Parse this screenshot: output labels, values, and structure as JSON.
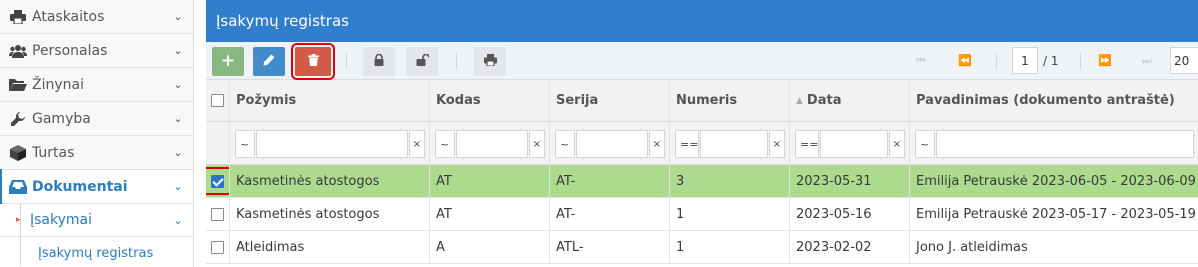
{
  "sidebar": {
    "items": [
      {
        "label": "Ataskaitos",
        "icon": "printer-icon"
      },
      {
        "label": "Personalas",
        "icon": "users-icon"
      },
      {
        "label": "Žinynai",
        "icon": "folder-open-icon"
      },
      {
        "label": "Gamyba",
        "icon": "wrench-icon"
      },
      {
        "label": "Turtas",
        "icon": "cube-icon"
      },
      {
        "label": "Dokumentai",
        "icon": "inbox-icon"
      }
    ],
    "sub_item": "Įsakymai",
    "sub_sub_item": "Įsakymų registras"
  },
  "panel": {
    "title": "Įsakymų registras"
  },
  "pager": {
    "page": "1",
    "of_text": "/ 1",
    "page_size": "20"
  },
  "grid": {
    "columns": [
      "Požymis",
      "Kodas",
      "Serija",
      "Numeris",
      "Data",
      "Pavadinimas (dokumento antraštė)"
    ],
    "filter_ops": [
      "~",
      "~",
      "~",
      "==",
      "==",
      "~"
    ],
    "clear_symbol": "×",
    "rows": [
      {
        "selected": true,
        "cells": [
          "Kasmetinės atostogos",
          "AT",
          "AT-",
          "3",
          "2023-05-31",
          "Emilija Petrauskė 2023-06-05 - 2023-06-09"
        ]
      },
      {
        "selected": false,
        "cells": [
          "Kasmetinės atostogos",
          "AT",
          "AT-",
          "1",
          "2023-05-16",
          "Emilija Petrauskė 2023-05-17 - 2023-05-19"
        ]
      },
      {
        "selected": false,
        "cells": [
          "Atleidimas",
          "A",
          "ATL-",
          "1",
          "2023-02-02",
          "Jono J. atleidimas"
        ]
      }
    ]
  },
  "colors": {
    "header_blue": "#307ecc",
    "selected_row": "#addb8e",
    "delete_red": "#d15b47",
    "add_green": "#87b87f",
    "edit_blue": "#428bca",
    "highlight_outline": "#e00000"
  }
}
